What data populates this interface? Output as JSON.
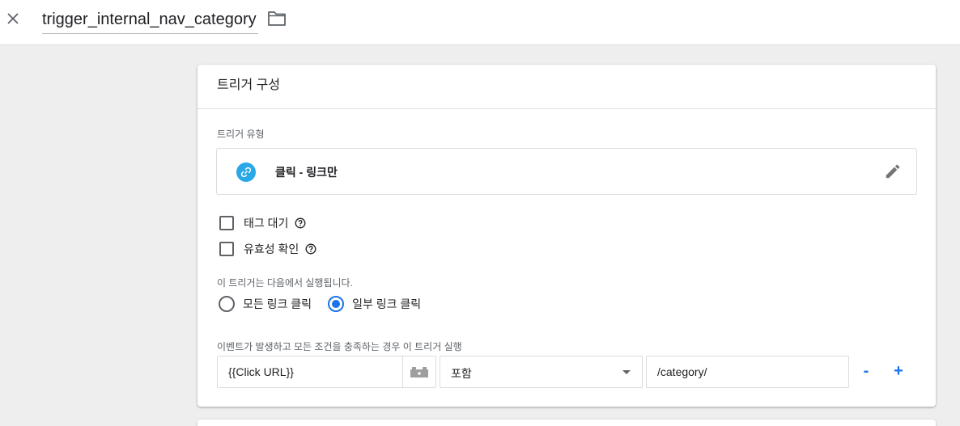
{
  "header": {
    "title": "trigger_internal_nav_category",
    "close_icon": "close-icon",
    "folder_icon": "folder-icon"
  },
  "card": {
    "title": "트리거 구성",
    "trigger_type_label": "트리거 유형",
    "trigger_type": {
      "name": "클릭 - 링크만",
      "icon": "link-icon",
      "icon_color": "#29a8e8"
    },
    "checkboxes": [
      {
        "label": "태그 대기",
        "checked": false
      },
      {
        "label": "유효성 확인",
        "checked": false
      }
    ],
    "fires_on_label": "이 트리거는 다음에서 실행됩니다.",
    "fire_options": [
      {
        "label": "모든 링크 클릭",
        "selected": false
      },
      {
        "label": "일부 링크 클릭",
        "selected": true
      }
    ],
    "condition_label": "이벤트가 발생하고 모든 조건을 충족하는 경우 이 트리거 실행",
    "condition": {
      "variable": "{{Click URL}}",
      "operator": "포함",
      "value": "/category/"
    },
    "remove_label": "-",
    "add_label": "+"
  },
  "colors": {
    "accent": "#1a73e8",
    "background": "#eeeeee"
  }
}
